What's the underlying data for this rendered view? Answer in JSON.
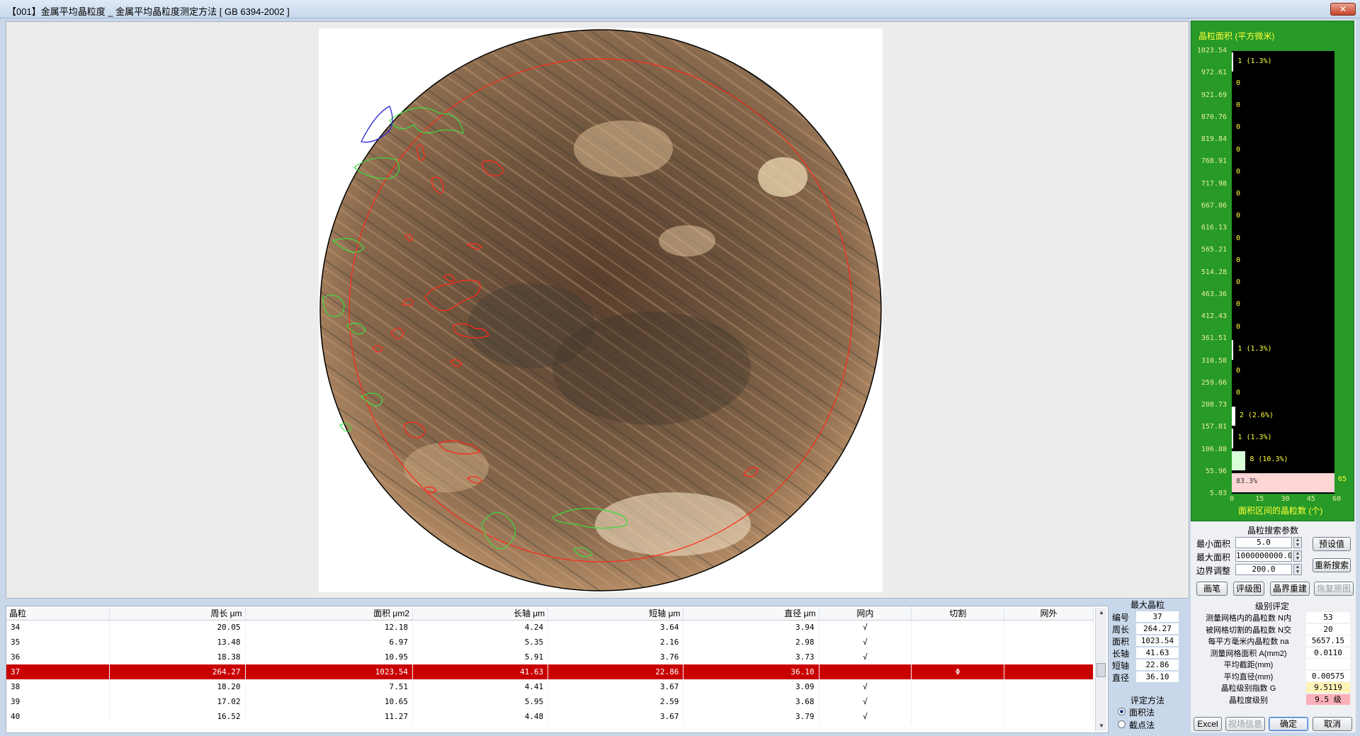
{
  "window": {
    "title": "【001】金属平均晶粒度 _ 金属平均晶粒度测定方法 [ GB 6394-2002 ]",
    "close_label": "✕"
  },
  "histogram": {
    "title": "晶粒面积 (平方微米)",
    "xlabel": "面积区间的晶粒数 (个)",
    "yticks": [
      "1023.54",
      "972.61",
      "921.69",
      "870.76",
      "819.84",
      "768.91",
      "717.98",
      "667.06",
      "616.13",
      "565.21",
      "514.28",
      "463.36",
      "412.43",
      "361.51",
      "310.58",
      "259.66",
      "208.73",
      "157.81",
      "106.88",
      "55.96",
      "5.03"
    ],
    "xticks": [
      "0",
      "15",
      "30",
      "45",
      "60"
    ],
    "bins": [
      {
        "count": 1,
        "label": "1 (1.3%)",
        "highlight": false
      },
      {
        "count": 0,
        "label": "0",
        "highlight": false
      },
      {
        "count": 0,
        "label": "0",
        "highlight": false
      },
      {
        "count": 0,
        "label": "0",
        "highlight": false
      },
      {
        "count": 0,
        "label": "0",
        "highlight": false
      },
      {
        "count": 0,
        "label": "0",
        "highlight": false
      },
      {
        "count": 0,
        "label": "0",
        "highlight": false
      },
      {
        "count": 0,
        "label": "0",
        "highlight": false
      },
      {
        "count": 0,
        "label": "0",
        "highlight": false
      },
      {
        "count": 0,
        "label": "0",
        "highlight": false
      },
      {
        "count": 0,
        "label": "0",
        "highlight": false
      },
      {
        "count": 0,
        "label": "0",
        "highlight": false
      },
      {
        "count": 0,
        "label": "0",
        "highlight": false
      },
      {
        "count": 1,
        "label": "1 (1.3%)",
        "highlight": false
      },
      {
        "count": 0,
        "label": "0",
        "highlight": false
      },
      {
        "count": 0,
        "label": "0",
        "highlight": false
      },
      {
        "count": 2,
        "label": "2 (2.6%)",
        "highlight": false
      },
      {
        "count": 1,
        "label": "1 (1.3%)",
        "highlight": false
      },
      {
        "count": 8,
        "label": "8 (10.3%)",
        "highlight": false
      },
      {
        "count": 65,
        "label": "83.3%",
        "highlight": true
      }
    ],
    "overflow_count": "65"
  },
  "search_params": {
    "title": "晶粒搜索参数",
    "min_area_label": "最小面积",
    "min_area_value": "5.0",
    "max_area_label": "最大面积",
    "max_area_value": "1000000000.0",
    "border_label": "边界调整",
    "border_value": "200.0",
    "preset_button": "预设值",
    "research_button": "重新搜索"
  },
  "tools": {
    "pen": "画笔",
    "grade_chart": "评级图",
    "rebuild": "晶界重建",
    "restore": "恢复原图"
  },
  "table": {
    "columns": [
      "晶粒",
      "周长 μm",
      "面积 μm2",
      "长轴 μm",
      "短轴 μm",
      "直径 μm",
      "网内",
      "切割",
      "网外"
    ],
    "rows": [
      {
        "id": "34",
        "perimeter": "20.05",
        "area": "12.18",
        "major": "4.24",
        "minor": "3.64",
        "diameter": "3.94",
        "inside": "√",
        "cut": "",
        "outside": "",
        "selected": false
      },
      {
        "id": "35",
        "perimeter": "13.48",
        "area": "6.97",
        "major": "5.35",
        "minor": "2.16",
        "diameter": "2.98",
        "inside": "√",
        "cut": "",
        "outside": "",
        "selected": false
      },
      {
        "id": "36",
        "perimeter": "18.38",
        "area": "10.95",
        "major": "5.91",
        "minor": "3.76",
        "diameter": "3.73",
        "inside": "√",
        "cut": "",
        "outside": "",
        "selected": false
      },
      {
        "id": "37",
        "perimeter": "264.27",
        "area": "1023.54",
        "major": "41.63",
        "minor": "22.86",
        "diameter": "36.10",
        "inside": "",
        "cut": "Φ",
        "outside": "",
        "selected": true
      },
      {
        "id": "38",
        "perimeter": "18.20",
        "area": "7.51",
        "major": "4.41",
        "minor": "3.67",
        "diameter": "3.09",
        "inside": "√",
        "cut": "",
        "outside": "",
        "selected": false
      },
      {
        "id": "39",
        "perimeter": "17.02",
        "area": "10.65",
        "major": "5.95",
        "minor": "2.59",
        "diameter": "3.68",
        "inside": "√",
        "cut": "",
        "outside": "",
        "selected": false
      },
      {
        "id": "40",
        "perimeter": "16.52",
        "area": "11.27",
        "major": "4.48",
        "minor": "3.67",
        "diameter": "3.79",
        "inside": "√",
        "cut": "",
        "outside": "",
        "selected": false
      }
    ]
  },
  "max_grain": {
    "title": "最大晶粒",
    "fields": [
      {
        "label": "编号",
        "value": "37"
      },
      {
        "label": "周长",
        "value": "264.27"
      },
      {
        "label": "面积",
        "value": "1023.54"
      },
      {
        "label": "长轴",
        "value": "41.63"
      },
      {
        "label": "短轴",
        "value": "22.86"
      },
      {
        "label": "直径",
        "value": "36.10"
      }
    ]
  },
  "method": {
    "title": "评定方法",
    "area_method": "面积法",
    "intercept_method": "截点法",
    "selected": "area"
  },
  "grading": {
    "title": "级别评定",
    "rows": [
      {
        "label": "测量网格内的晶粒数 N内",
        "value": "53",
        "color": "#ffffff"
      },
      {
        "label": "被网格切割的晶粒数 N交",
        "value": "20",
        "color": "#ffffff"
      },
      {
        "label": "每平方毫米内晶粒数 na",
        "value": "5657.15",
        "color": "#ffffff"
      },
      {
        "label": "测量网格面积 A(mm2)",
        "value": "0.0110",
        "color": "#ffffff"
      },
      {
        "label": "平均截距(mm)",
        "value": "",
        "color": "#ffffff"
      },
      {
        "label": "平均直径(mm)",
        "value": "0.00575",
        "color": "#ffffff"
      },
      {
        "label": "晶粒级别指数 G",
        "value": "9.5119",
        "color": "#fff4b8"
      },
      {
        "label": "晶粒度级别",
        "value": "9.5 级",
        "color": "#f9b0b8"
      }
    ]
  },
  "bottom_buttons": {
    "excel": "Excel",
    "field_info": "视场信息",
    "ok": "确定",
    "cancel": "取消"
  },
  "colors": {
    "selected_row": "#c90000",
    "histogram_bg": "#279a28",
    "grain_outline_inside": "#ff2a1a",
    "grain_outline_border": "#3ddc3d",
    "grain_outline_max": "#2a2ad6"
  }
}
